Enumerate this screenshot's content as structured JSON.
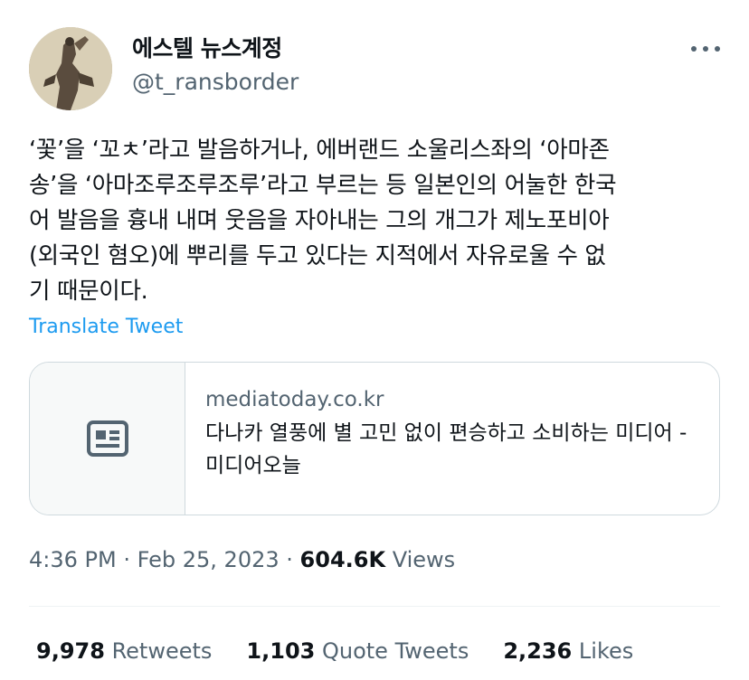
{
  "author": {
    "display_name": "에스텔 뉴스계정",
    "handle": "@t_ransborder"
  },
  "tweet": {
    "text": "‘꽃’을 ‘꼬ㅊ’라고 발음하거나, 에버랜드 소울리스좌의 ‘아마존\n송’을 ‘아마조루조루조루’라고 부르는 등 일본인의 어눌한 한국\n어 발음을 흉내 내며 웃음을 자아내는 그의 개그가 제노포비아\n(외국인 혐오)에 뿌리를 두고 있다는 지적에서 자유로울 수 없\n기 때문이다.",
    "translate_label": "Translate Tweet"
  },
  "link_card": {
    "domain": "mediatoday.co.kr",
    "title": "다나카 열풍에 별 고민 없이 편승하고 소비하는 미디어 - 미디어오늘",
    "icon": "article-icon"
  },
  "meta": {
    "time": "4:36 PM",
    "separator": "·",
    "date": "Feb 25, 2023",
    "views_count": "604.6K",
    "views_label": "Views"
  },
  "stats": {
    "retweets_count": "9,978",
    "retweets_label": "Retweets",
    "quotes_count": "1,103",
    "quotes_label": "Quote Tweets",
    "likes_count": "2,236",
    "likes_label": "Likes"
  },
  "colors": {
    "link": "#1d9bf0",
    "secondary_text": "#536471",
    "border": "#cfd9de"
  }
}
